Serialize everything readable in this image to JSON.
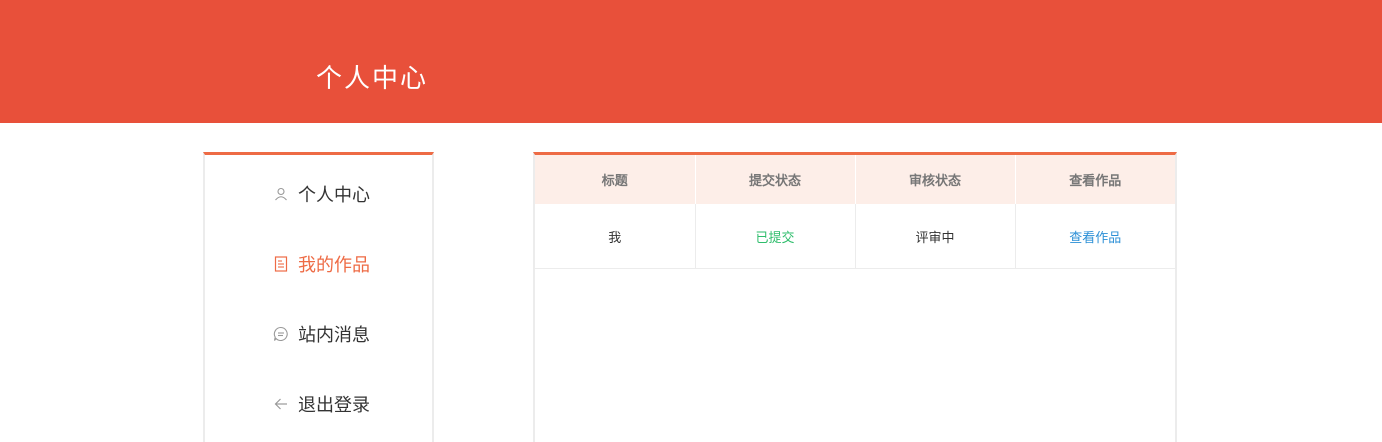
{
  "header": {
    "title": "个人中心"
  },
  "sidebar": {
    "items": [
      {
        "label": "个人中心",
        "icon": "user-icon"
      },
      {
        "label": "我的作品",
        "icon": "document-icon",
        "active": true
      },
      {
        "label": "站内消息",
        "icon": "message-icon"
      },
      {
        "label": "退出登录",
        "icon": "arrow-left-icon"
      }
    ]
  },
  "table": {
    "columns": [
      "标题",
      "提交状态",
      "审核状态",
      "查看作品"
    ],
    "rows": [
      {
        "title": "我",
        "submit_status": "已提交",
        "review_status": "评审中",
        "action": "查看作品"
      }
    ]
  },
  "colors": {
    "brand": "#e8503a",
    "accent": "#ee6b45",
    "success": "#2ebd6b",
    "link": "#2b8fd6"
  }
}
